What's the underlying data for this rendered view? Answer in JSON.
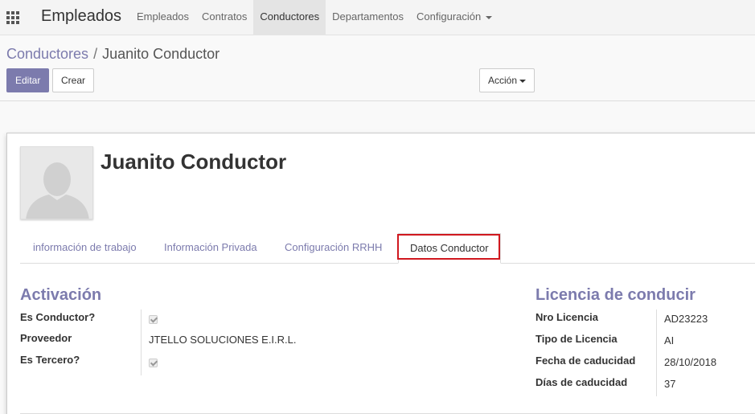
{
  "app_title": "Empleados",
  "nav": [
    "Empleados",
    "Contratos",
    "Conductores",
    "Departamentos",
    "Configuración"
  ],
  "nav_active": "Conductores",
  "breadcrumb": {
    "parent": "Conductores",
    "separator": "/",
    "current": "Juanito Conductor"
  },
  "buttons": {
    "edit": "Editar",
    "create": "Crear",
    "action": "Acción"
  },
  "record": {
    "name": "Juanito Conductor"
  },
  "tabs": [
    "información de trabajo",
    "Información Privada",
    "Configuración RRHH",
    "Datos Conductor"
  ],
  "tab_active": "Datos Conductor",
  "activation": {
    "title": "Activación",
    "fields": [
      {
        "label": "Es Conductor?",
        "checked": true
      },
      {
        "label": "Proveedor",
        "value": "JTELLO SOLUCIONES E.I.R.L."
      },
      {
        "label": "Es Tercero?",
        "checked": true
      }
    ]
  },
  "license": {
    "title": "Licencia de conducir",
    "fields": [
      {
        "label": "Nro Licencia",
        "value": "AD23223"
      },
      {
        "label": "Tipo de Licencia",
        "value": "AI"
      },
      {
        "label": "Fecha de caducidad",
        "value": "28/10/2018"
      },
      {
        "label": "Días de caducidad",
        "value": "37"
      }
    ]
  },
  "colors": {
    "accent": "#7c7bad",
    "highlight": "#d0181f"
  }
}
